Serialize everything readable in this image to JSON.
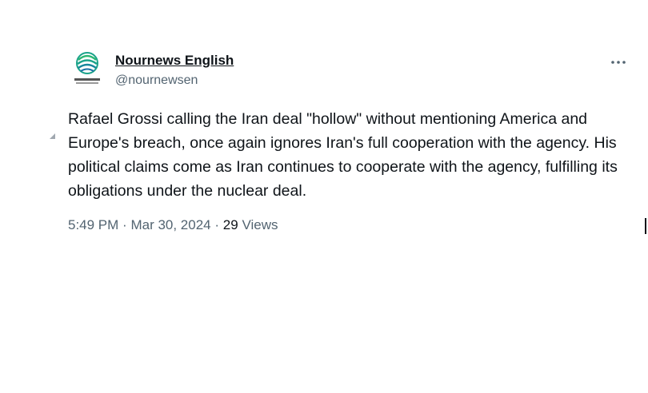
{
  "author": {
    "display_name": "Nournews English",
    "handle": "@nournewsen",
    "avatar_icon": "nournews-logo-icon",
    "logo_color": "#1aa38a"
  },
  "tweet": {
    "text": "Rafael Grossi calling the Iran deal \"hollow\" without mentioning America and Europe's breach, once again ignores Iran's full cooperation with the agency. His political claims come as Iran continues to cooperate with the agency, fulfilling its obligations under the nuclear deal.",
    "time": "5:49 PM",
    "date": "Mar 30, 2024",
    "separator": "·",
    "views_count": "29",
    "views_label": "Views"
  },
  "menu": {
    "more_icon": "more-options-icon"
  }
}
